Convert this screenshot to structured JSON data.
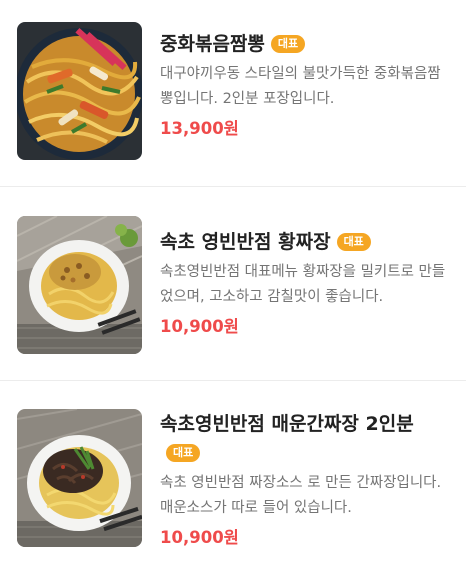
{
  "menu": {
    "items": [
      {
        "name": "중화볶음짬뽕",
        "badge": "대표",
        "description": "대구야끼우동 스타일의 불맛가득한 중화볶음짬뽕입니다. 2인분 포장입니다.",
        "price": "13,900원",
        "image_icon": "stir-fried-noodle-image"
      },
      {
        "name": "속초 영빈반점 황짜장",
        "badge": "대표",
        "description": "속초영빈반점 대표메뉴 황짜장을 밀키트로 만들었으며, 고소하고 감칠맛이 좋습니다.",
        "price": "10,900원",
        "image_icon": "yellow-jjajang-image"
      },
      {
        "name": "속초영빈반점 매운간짜장 2인분",
        "badge": "대표",
        "description": "속초 영빈반점 짜장소스 로 만든 간짜장입니다. 매운소스가 따로 들어 있습니다.",
        "price": "10,900원",
        "image_icon": "spicy-ganjjajang-image"
      }
    ]
  }
}
